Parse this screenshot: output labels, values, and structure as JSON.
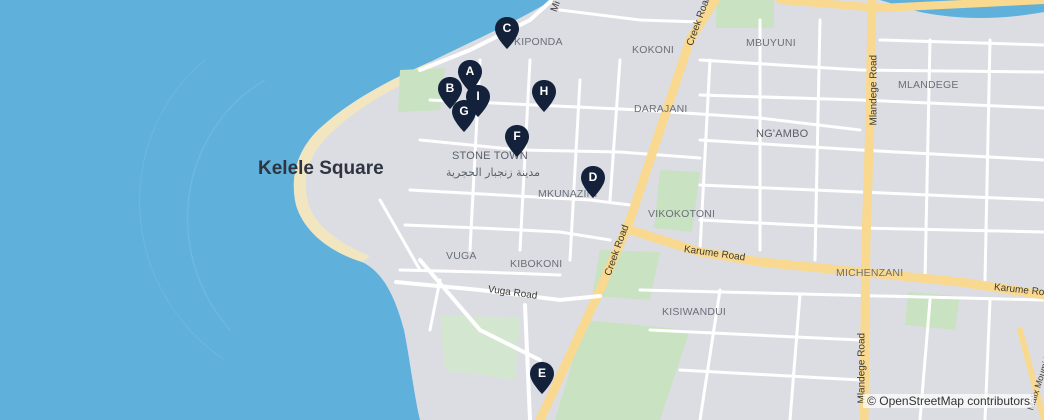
{
  "map": {
    "colors": {
      "water": "#5fb0db",
      "land": "#dcdde3",
      "road_major": "#f8d98f",
      "road_minor": "#ffffff",
      "park": "#c9e2c2",
      "beach": "#f2e6c0",
      "marker": "#13223a"
    },
    "area_labels": {
      "kelele": "Kelele Square",
      "stone_town": "STONE TOWN",
      "stone_town_arabic": "مدينة زنجبار الحجرية",
      "kiponda": "KIPONDA",
      "kokoni": "KOKONI",
      "mbuyuni": "MBUYUNI",
      "mlandege": "MLANDEGE",
      "darajani": "DARAJANI",
      "ngambo": "NG'AMBO",
      "mkunazini": "MKUNAZINI",
      "vikokotoni": "VIKOKOTONI",
      "vuga": "VUGA",
      "kibokoni": "KIBOKONI",
      "michenzani": "MICHENZANI",
      "kisiwandui": "KISIWANDUI"
    },
    "road_labels": {
      "creek_upper": "Creek Road",
      "creek_lower": "Creek Road",
      "karume": "Karume Road",
      "karume_east": "Karume Road",
      "vuga": "Vuga Road",
      "mlandege_upper": "Mlandege Road",
      "mlandege_lower": "Mlandege Road",
      "mizingani": "Mi",
      "mfumoni": "Malix Moumi Roa"
    },
    "markers": [
      {
        "id": "marker-a",
        "label": "A"
      },
      {
        "id": "marker-b",
        "label": "B"
      },
      {
        "id": "marker-c",
        "label": "C"
      },
      {
        "id": "marker-d",
        "label": "D"
      },
      {
        "id": "marker-e",
        "label": "E"
      },
      {
        "id": "marker-f",
        "label": "F"
      },
      {
        "id": "marker-g",
        "label": "G"
      },
      {
        "id": "marker-h",
        "label": "H"
      },
      {
        "id": "marker-i",
        "label": "I"
      }
    ],
    "attribution": "© OpenStreetMap contributors"
  }
}
